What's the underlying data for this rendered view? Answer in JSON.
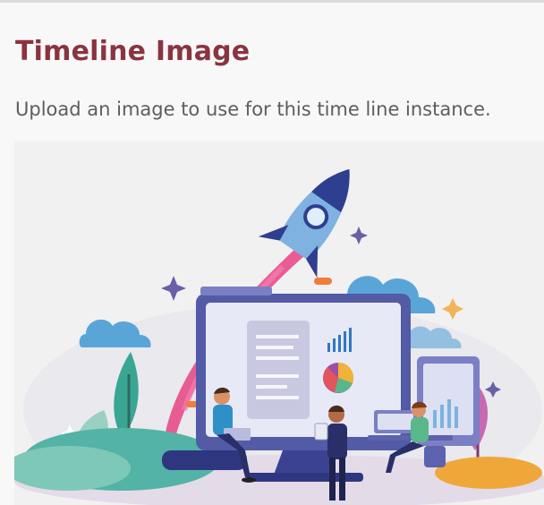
{
  "section": {
    "title": "Timeline Image",
    "description": "Upload an image to use for this time line instance."
  },
  "image": {
    "subject": "rocket launch illustration with computer monitor and people"
  },
  "colors": {
    "title": "#8a3440",
    "description": "#5d5d5d",
    "image_background": "#f1f1f1"
  }
}
